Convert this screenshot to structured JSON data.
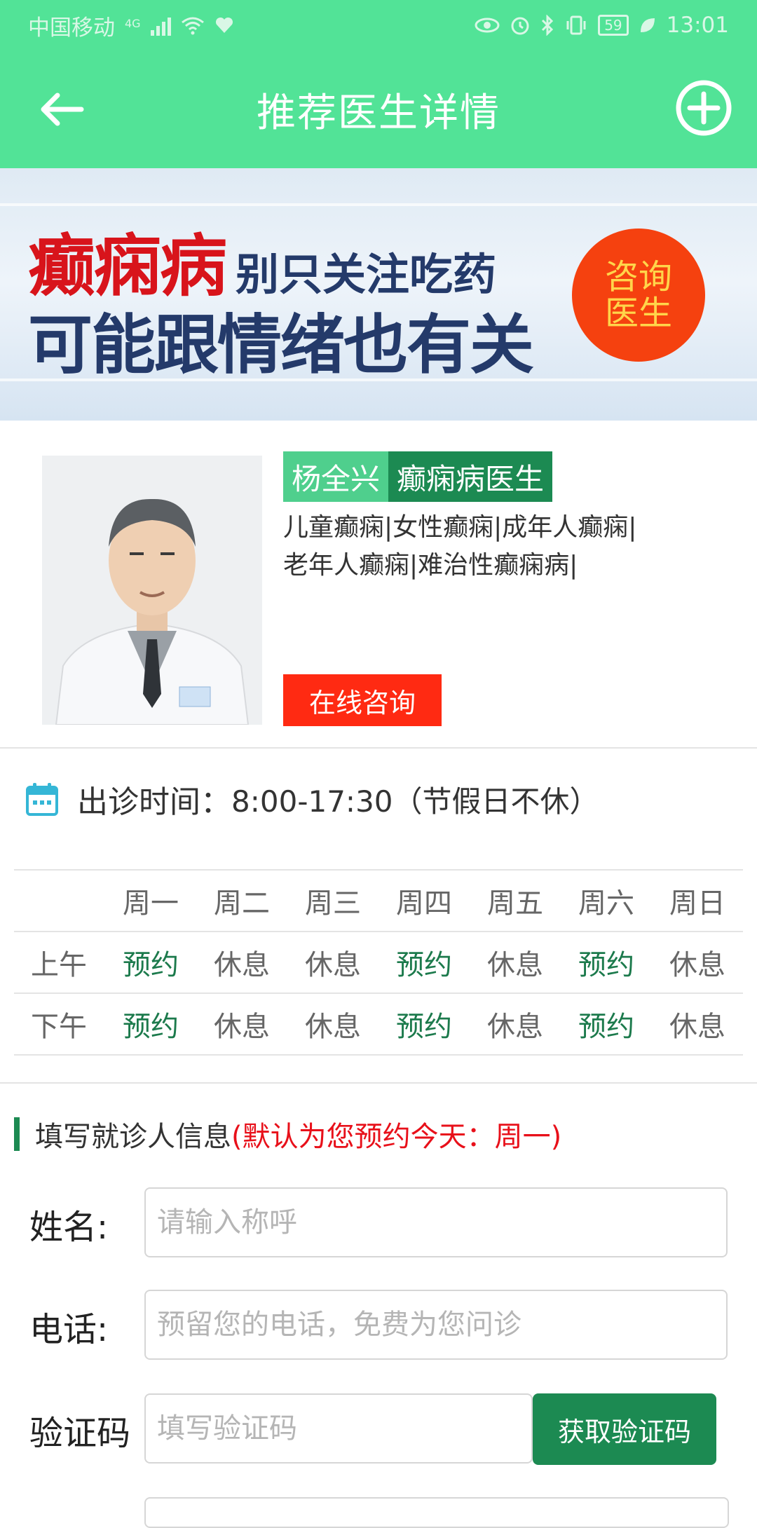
{
  "status_bar": {
    "carrier": "中国移动",
    "network": "4G",
    "battery": "59",
    "time": "13:01"
  },
  "header": {
    "title": "推荐医生详情"
  },
  "banner": {
    "headline_red": "癫痫病",
    "headline_small": "别只关注吃药",
    "headline_line2": "可能跟情绪也有关",
    "consult_line1": "咨询",
    "consult_line2": "医生"
  },
  "doctor": {
    "name": "杨全兴",
    "title": "癫痫病医生",
    "specialties_line1": "儿童癫痫|女性癫痫|成年人癫痫|",
    "specialties_line2": "老年人癫痫|难治性癫痫病|",
    "consult_button": "在线咨询"
  },
  "clinic_hours": {
    "label": "出诊时间：",
    "value": "8:00-17:30（节假日不休）"
  },
  "schedule": {
    "days": [
      "周一",
      "周二",
      "周三",
      "周四",
      "周五",
      "周六",
      "周日"
    ],
    "rows": [
      {
        "period": "上午",
        "slots": [
          "预约",
          "休息",
          "休息",
          "预约",
          "休息",
          "预约",
          "休息"
        ]
      },
      {
        "period": "下午",
        "slots": [
          "预约",
          "休息",
          "休息",
          "预约",
          "休息",
          "预约",
          "休息"
        ]
      }
    ]
  },
  "form": {
    "title": "填写就诊人信息",
    "note": "(默认为您预约今天：周一)",
    "name_label": "姓名:",
    "name_placeholder": "请输入称呼",
    "phone_label": "电话:",
    "phone_placeholder": "预留您的电话，免费为您问诊",
    "code_label": "验证码",
    "code_placeholder": "填写验证码",
    "code_button": "获取验证码"
  },
  "colors": {
    "header_green": "#52e397",
    "accent_green": "#1c8a52",
    "consult_red": "#ff2a12",
    "note_red": "#e8101a"
  }
}
